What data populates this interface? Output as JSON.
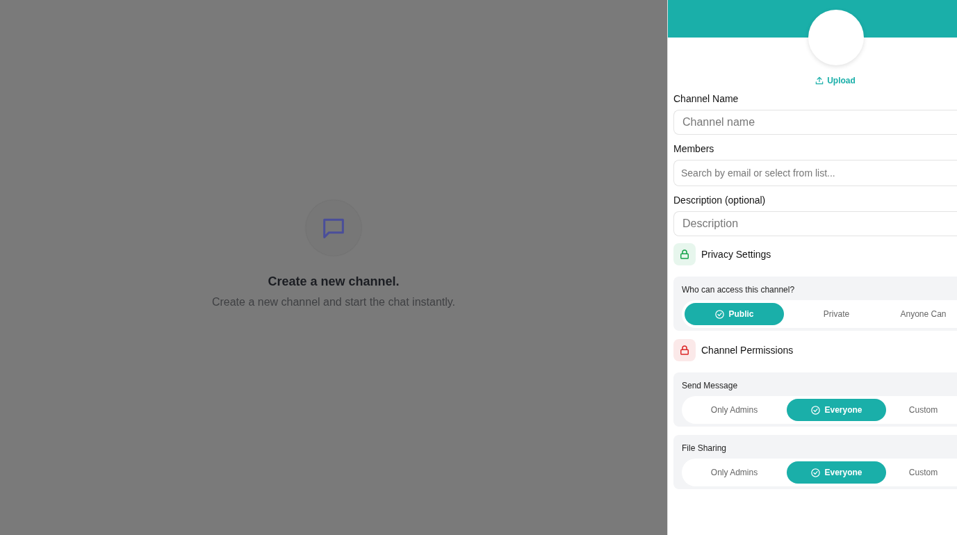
{
  "empty_state": {
    "title": "Create a new channel.",
    "subtitle": "Create a new channel and start the chat instantly."
  },
  "panel": {
    "upload": "Upload",
    "fields": [
      {
        "label": "Channel Name",
        "placeholder": "Channel name",
        "kind": "large"
      },
      {
        "label": "Members",
        "placeholder": "Search by email or select from list...",
        "kind": "small"
      },
      {
        "label": "Description (optional)",
        "placeholder": "Description",
        "kind": "large"
      }
    ],
    "sections": [
      {
        "title": "Privacy Settings",
        "color": "#16a34a",
        "groups": [
          {
            "question": "Who can access this channel?",
            "options": [
              {
                "label": "Public",
                "selected": true
              },
              {
                "label": "Private",
                "selected": false
              },
              {
                "label": "Anyone Can",
                "selected": false
              }
            ]
          }
        ]
      },
      {
        "title": "Channel Permissions",
        "color": "#dc2626",
        "groups": [
          {
            "question": "Send Message",
            "options": [
              {
                "label": "Only Admins",
                "selected": false
              },
              {
                "label": "Everyone",
                "selected": true
              },
              {
                "label": "Custom",
                "selected": false
              }
            ]
          },
          {
            "question": "File Sharing",
            "options": [
              {
                "label": "Only Admins",
                "selected": false
              },
              {
                "label": "Everyone",
                "selected": true
              },
              {
                "label": "Custom",
                "selected": false
              }
            ]
          }
        ]
      }
    ]
  }
}
